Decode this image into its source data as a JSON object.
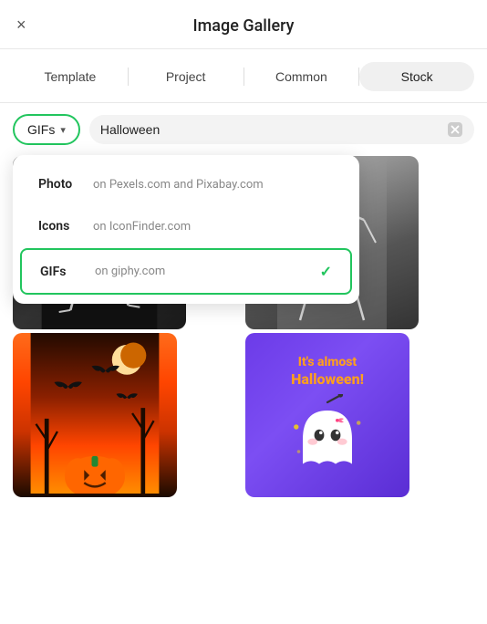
{
  "header": {
    "title": "Image Gallery",
    "close_label": "×"
  },
  "tabs": [
    {
      "id": "template",
      "label": "Template",
      "active": false
    },
    {
      "id": "project",
      "label": "Project",
      "active": false
    },
    {
      "id": "common",
      "label": "Common",
      "active": false
    },
    {
      "id": "stock",
      "label": "Stock",
      "active": true
    }
  ],
  "search": {
    "dropdown_label": "GIFs",
    "query": "Halloween",
    "placeholder": "Search..."
  },
  "dropdown": {
    "items": [
      {
        "name": "Photo",
        "desc": "on Pexels.com and Pixabay.com",
        "selected": false
      },
      {
        "name": "Icons",
        "desc": "on IconFinder.com",
        "selected": false
      },
      {
        "name": "GIFs",
        "desc": "on giphy.com",
        "selected": true
      }
    ]
  },
  "ghost_card": {
    "line1": "It's almost",
    "line2": "Halloween!"
  },
  "colors": {
    "green": "#22c55e",
    "purple": "#6c3be8",
    "orange": "#ff9f1c"
  }
}
